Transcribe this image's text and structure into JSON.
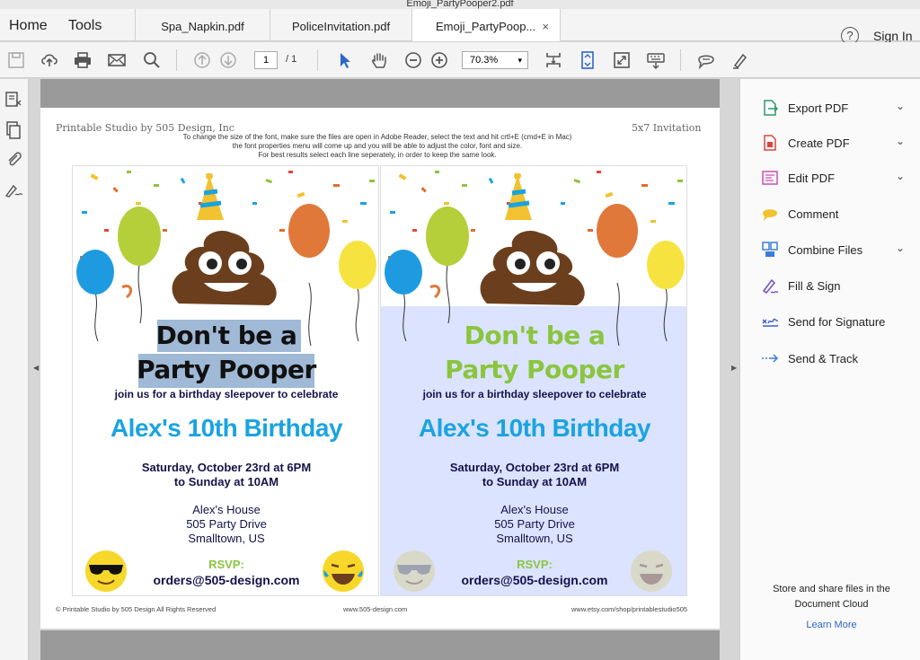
{
  "window": {
    "title": "Emoji_PartyPooper2.pdf"
  },
  "nav": {
    "home": "Home",
    "tools": "Tools",
    "help_glyph": "?",
    "sign_in": "Sign In"
  },
  "tabs": [
    {
      "label": "Spa_Napkin.pdf"
    },
    {
      "label": "PoliceInvitation.pdf"
    },
    {
      "label": "Emoji_PartyPoop...",
      "close": "×"
    }
  ],
  "toolbar": {
    "page_current": "1",
    "page_total": "/ 1",
    "zoom": "70.3%",
    "zoom_arrow": "▾",
    "icons": [
      "save-icon",
      "upload-icon",
      "print-icon",
      "email-icon",
      "search-icon",
      "prev-page-icon",
      "next-page-icon",
      "select-cursor-icon",
      "hand-icon",
      "zoom-out-icon",
      "zoom-in-icon",
      "fit-page-icon",
      "scroll-mode-icon",
      "fullscreen-icon",
      "keyboard-icon",
      "comment-icon",
      "highlight-icon"
    ]
  },
  "document": {
    "header_left": "Printable Studio by 505 Design, Inc",
    "header_right": "5x7 Invitation",
    "instructions": [
      "To change the size of the font, make sure the files are open in Adobe Reader, select the text and hit crtl+E (cmd+E in Mac)",
      "the font properties menu will come up and you will be able to adjust the color, font and size.",
      "For best results select each line seperately, in order to keep the same look."
    ],
    "card": {
      "title_line1": "Don't be a",
      "title_line2": "Party Pooper",
      "join": "join us for a birthday sleepover to celebrate",
      "birthday": "Alex's 10th Birthday",
      "date_line1": "Saturday, October 23rd at 6PM",
      "date_line2": "to Sunday at 10AM",
      "addr_line1": "Alex's House",
      "addr_line2": "505 Party Drive",
      "addr_line3": "Smalltown, US",
      "rsvp": "RSVP:",
      "email": "orders@505-design.com"
    },
    "footer_left": "© Printable Studio by 505 Design All Rights Reserved",
    "footer_center": "www.505-design.com",
    "footer_right": "www.etsy.com/shop/printablestudio505"
  },
  "right_panel": {
    "items": [
      {
        "label": "Export PDF",
        "icon": "export-pdf-icon",
        "expandable": true,
        "color": "#2a9d6e"
      },
      {
        "label": "Create PDF",
        "icon": "create-pdf-icon",
        "expandable": true,
        "color": "#d9453b"
      },
      {
        "label": "Edit PDF",
        "icon": "edit-pdf-icon",
        "expandable": true,
        "color": "#c94fb3"
      },
      {
        "label": "Comment",
        "icon": "comment-icon",
        "expandable": false,
        "color": "#f2c230"
      },
      {
        "label": "Combine Files",
        "icon": "combine-files-icon",
        "expandable": true,
        "color": "#3b7dd8"
      },
      {
        "label": "Fill & Sign",
        "icon": "fill-sign-icon",
        "expandable": false,
        "color": "#6b4fc9"
      },
      {
        "label": "Send for Signature",
        "icon": "send-signature-icon",
        "expandable": false,
        "color": "#3b5fc9"
      },
      {
        "label": "Send & Track",
        "icon": "send-track-icon",
        "expandable": false,
        "color": "#3b7dd8"
      }
    ],
    "chevron": "⌄",
    "cloud_line1": "Store and share files in the",
    "cloud_line2": "Document Cloud",
    "learn_more": "Learn More"
  }
}
